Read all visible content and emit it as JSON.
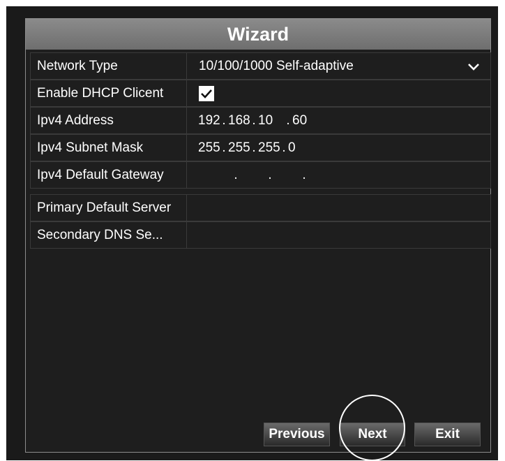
{
  "dialog": {
    "title": "Wizard"
  },
  "fields": {
    "network_type": {
      "label": "Network Type",
      "value": "10/100/1000 Self-adaptive"
    },
    "dhcp": {
      "label": "Enable DHCP Clicent",
      "checked": true
    },
    "ipv4_address": {
      "label": "Ipv4 Address",
      "octets": [
        "192",
        "168",
        "10",
        "60"
      ]
    },
    "ipv4_subnet": {
      "label": "Ipv4 Subnet Mask",
      "octets": [
        "255",
        "255",
        "255",
        "0"
      ]
    },
    "ipv4_gateway": {
      "label": "Ipv4 Default Gateway",
      "octets": [
        "",
        "",
        "",
        ""
      ]
    },
    "primary_dns": {
      "label": "Primary Default Server",
      "value": ""
    },
    "secondary_dns": {
      "label": "Secondary DNS Se...",
      "value": ""
    }
  },
  "buttons": {
    "previous": "Previous",
    "next": "Next",
    "exit": "Exit"
  },
  "icons": {
    "dropdown": "chevron-down-icon",
    "check": "checkmark-icon"
  },
  "colors": {
    "background": "#1e1e1e",
    "title_bar": "#7c7c7c",
    "text": "#ffffff",
    "highlight_circle": "#ffffff"
  }
}
